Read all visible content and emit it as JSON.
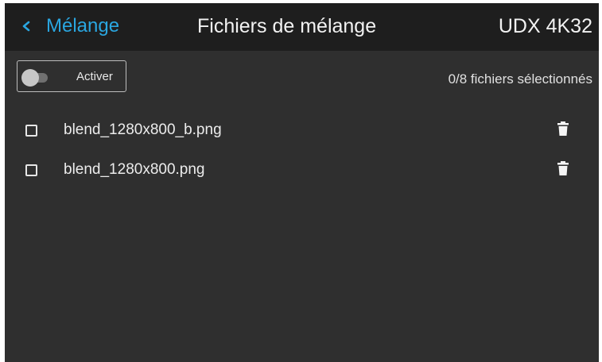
{
  "header": {
    "back_label": "Mélange",
    "title": "Fichiers de mélange",
    "model": "UDX 4K32"
  },
  "toolbar": {
    "toggle_label": "Activer",
    "toggle_on": false,
    "selection_count": "0/8 fichiers sélectionnés"
  },
  "files": [
    {
      "name": "blend_1280x800_b.png",
      "checked": false,
      "icon": "trash-icon"
    },
    {
      "name": "blend_1280x800.png",
      "checked": false,
      "icon": "trash-icon"
    }
  ],
  "colors": {
    "background": "#2f2f2f",
    "header_background": "#1e1e1e",
    "accent": "#2aa6e0",
    "text": "#f2f2f2"
  }
}
